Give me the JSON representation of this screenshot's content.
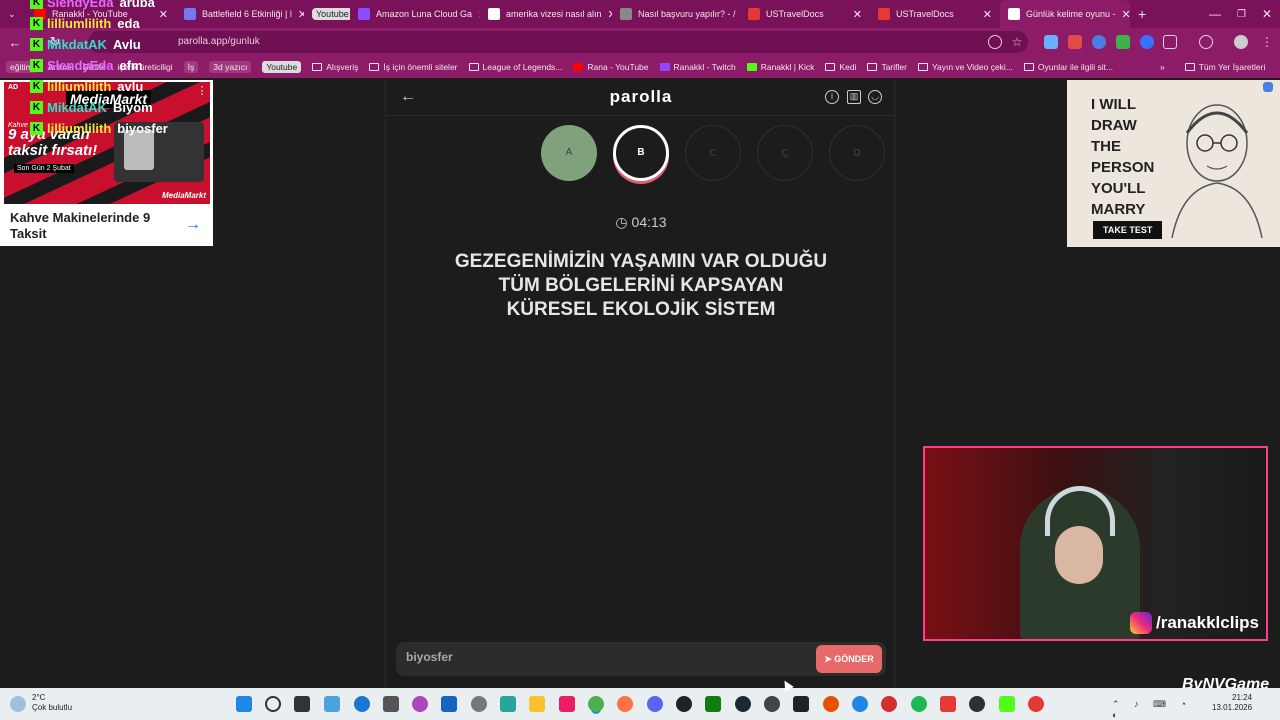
{
  "colors": {
    "accent": "#8c1c68",
    "done": "#7fa27d",
    "send": "#e8696a",
    "kick": "#53fc18",
    "webcam_border": "#ff3c8e"
  },
  "tabs": [
    {
      "label": "Ranakkl - YouTube",
      "icon": "youtube-icon",
      "color": "#ff0000"
    },
    {
      "label": "Battlefield 6 Etkinliği | l",
      "icon": "page-icon",
      "color": "#6f7cf0"
    },
    {
      "label": "Youtube",
      "icon": "",
      "color": "",
      "badge": true
    },
    {
      "label": "Amazon Luna Cloud Ga",
      "icon": "luna-icon",
      "color": "#8a4dff"
    },
    {
      "label": "amerika vizesi nasıl alın",
      "icon": "google-icon",
      "color": "#fff"
    },
    {
      "label": "Nasıl başvuru yapılır? - /",
      "icon": "page-icon",
      "color": "#888"
    },
    {
      "label": "USTravelDocs",
      "icon": "cgi-icon",
      "color": "#e53935"
    },
    {
      "label": "USTravelDocs",
      "icon": "cgi-icon",
      "color": "#e53935"
    },
    {
      "label": "Günlük kelime oyunu -",
      "icon": "parolla-icon",
      "color": "#fff",
      "active": true
    }
  ],
  "address": {
    "url": "parolla.app/gunluk"
  },
  "bookmarks": [
    {
      "label": "eğitim",
      "style": "pill"
    },
    {
      "label": "Anime",
      "style": "plain"
    },
    {
      "label": "Diziler",
      "style": "plain"
    },
    {
      "label": "içerik üreticiligi",
      "style": "plain"
    },
    {
      "label": "İş",
      "style": "pill"
    },
    {
      "label": "3d yazıcı",
      "style": "pill"
    },
    {
      "label": "Youtube",
      "style": "yt"
    },
    {
      "label": "Alışveriş",
      "style": "folder"
    },
    {
      "label": "İş için önemli siteler",
      "style": "folder"
    },
    {
      "label": "League of Legends...",
      "style": "folder"
    },
    {
      "label": "Rana - YouTube",
      "style": "yticon"
    },
    {
      "label": "Ranakkl - Twitch",
      "style": "twitch"
    },
    {
      "label": "Ranakkl | Kick",
      "style": "kick"
    },
    {
      "label": "Kedi",
      "style": "folder"
    },
    {
      "label": "Tarifler",
      "style": "folder"
    },
    {
      "label": "Yayın ve Video çeki...",
      "style": "folder"
    },
    {
      "label": "Oyunlar ile ilgili sit...",
      "style": "folder"
    }
  ],
  "bookmarks_more": "»",
  "bookmarks_all": "Tüm Yer İşaretleri",
  "left_ad": {
    "tag": "AD",
    "brand": "MediaMarkt",
    "small": "Kahve ma",
    "promo": "9 aya varan\ntaksit fırsatı!",
    "sub": "Son Gün 2 Şubat",
    "badge": "MediaMarkt",
    "caption": "Kahve Makinelerinde 9 Taksit"
  },
  "right_ad": {
    "headline": "I WILL\nDRAW\nTHE\nPERSON\nYOU'LL\nMARRY",
    "button": "TAKE TEST"
  },
  "game": {
    "title": "parolla",
    "letters": [
      {
        "char": "A",
        "state": "done"
      },
      {
        "char": "B",
        "state": "current"
      },
      {
        "char": "C",
        "state": "todo"
      },
      {
        "char": "Ç",
        "state": "todo"
      },
      {
        "char": "D",
        "state": "todo"
      }
    ],
    "timer": "04:13",
    "question": "GEZEGENİMİZİN YAŞAMIN VAR OLDUĞU\nTÜM BÖLGELERİNİ KAPSAYAN\nKÜRESEL EKOLOJİK SİSTEM",
    "answer": "biyosfer",
    "send_label": "GÖNDER"
  },
  "chat": [
    {
      "user": "SlendyEda",
      "msg": "aruba",
      "color": "#e46bff"
    },
    {
      "user": "lilliumlilith",
      "msg": "eda",
      "color": "#ffe23d"
    },
    {
      "user": "MikdatAK",
      "msg": "Avlu",
      "color": "#31e0c8"
    },
    {
      "user": "SlendyEda",
      "msg": "efm",
      "color": "#e46bff"
    },
    {
      "user": "lilliumlilith",
      "msg": "avlu",
      "color": "#ffe23d"
    },
    {
      "user": "MikdatAK",
      "msg": "Biyom",
      "color": "#31e0c8"
    },
    {
      "user": "lilliumlilith",
      "msg": "biyosfer",
      "color": "#ffe23d"
    }
  ],
  "webcam": {
    "handle": "/ranakklclips"
  },
  "watermark": "ByNVGame",
  "taskbar": {
    "weather_temp": "2°C",
    "weather_desc": "Çok bulutlu",
    "time": "21:24",
    "date": "13.01.2026"
  }
}
